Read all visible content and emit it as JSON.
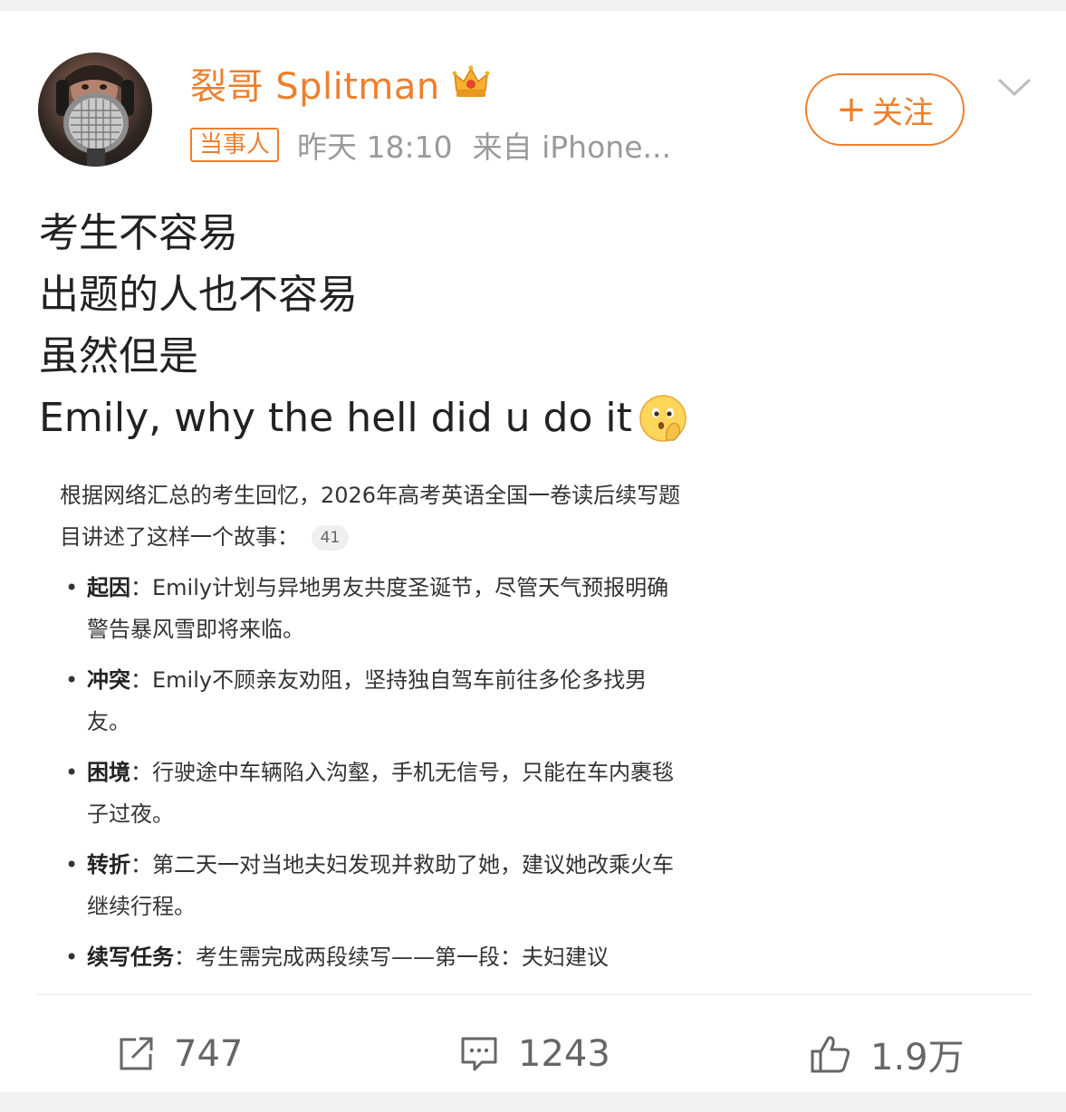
{
  "post": {
    "author": {
      "name": "裂哥 Splitman",
      "badge": "当事人",
      "avatar": "avatar",
      "vip_icon": "crown-icon"
    },
    "timestamp": "昨天 18:10",
    "source": "来自 iPhone...",
    "follow_label": "关注",
    "follow_icon": "plus-icon",
    "menu_icon": "chevron-down-icon",
    "text_lines": [
      "考生不容易",
      "出题的人也不容易",
      "虽然但是",
      "Emily, why the hell did u do it"
    ],
    "text_emoji": "thinking-face-emoji"
  },
  "embed": {
    "intro": "根据网络汇总的考生回忆，2026年高考英语全国一卷读后续写题目讲述了这样一个故事：",
    "ref_count": "41",
    "bullets": [
      {
        "term": "起因",
        "sep": "：",
        "text": "Emily计划与异地男友共度圣诞节，尽管天气预报明确警告暴风雪即将来临。"
      },
      {
        "term": "冲突",
        "sep": "：",
        "text": "Emily不顾亲友劝阻，坚持独自驾车前往多伦多找男友。"
      },
      {
        "term": "困境",
        "sep": "：",
        "text": "行驶途中车辆陷入沟壑，手机无信号，只能在车内裹毯子过夜。"
      },
      {
        "term": "转折",
        "sep": "：",
        "text": "第二天一对当地夫妇发现并救助了她，建议她改乘火车继续行程。"
      },
      {
        "term": "续写任务",
        "sep": "：",
        "text": "考生需完成两段续写——第一段：夫妇建议"
      }
    ]
  },
  "actions": {
    "repost": {
      "icon": "share-icon",
      "count": "747"
    },
    "comment": {
      "icon": "comment-icon",
      "count": "1243"
    },
    "like": {
      "icon": "thumbs-up-icon",
      "count": "1.9万"
    }
  },
  "colors": {
    "accent": "#ee7f2d",
    "text": "#222222",
    "meta": "#9a9a9a",
    "background": "#f2f2f2"
  }
}
